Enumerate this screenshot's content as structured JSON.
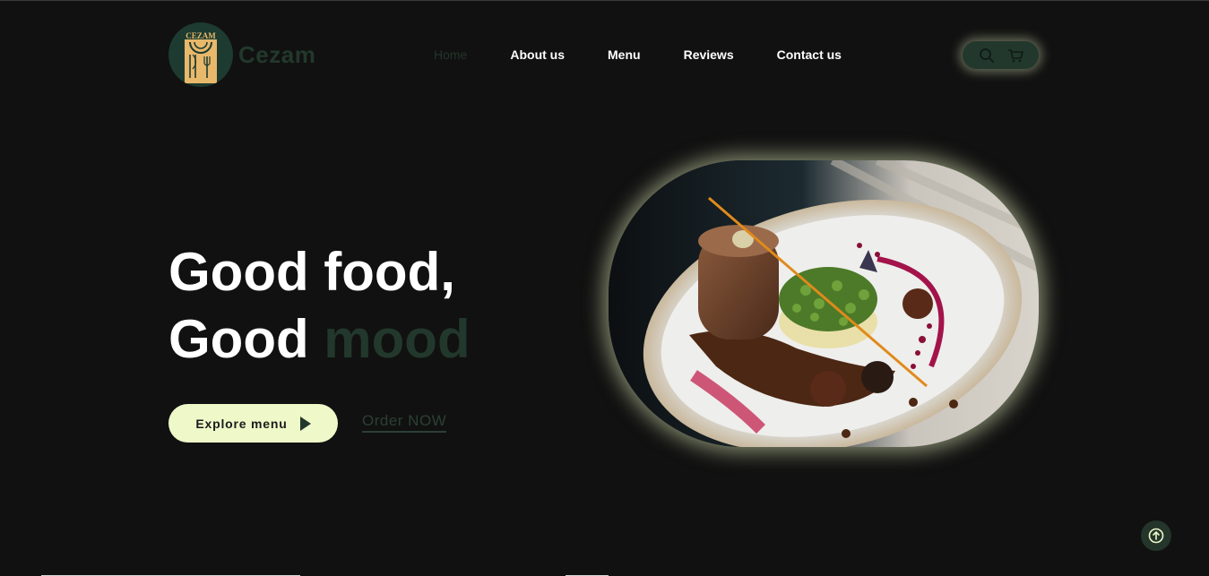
{
  "brand": {
    "name": "Cezam",
    "logo_text": "CEZAM"
  },
  "nav": {
    "items": [
      {
        "label": "Home",
        "active": true
      },
      {
        "label": "About us",
        "active": false
      },
      {
        "label": "Menu",
        "active": false
      },
      {
        "label": "Reviews",
        "active": false
      },
      {
        "label": "Contact us",
        "active": false
      }
    ]
  },
  "tools": {
    "search_icon": "search-icon",
    "cart_icon": "cart-icon"
  },
  "hero": {
    "line1": "Good food,",
    "line2_plain": "Good",
    "line2_accent": "mood",
    "explore_label": "Explore menu",
    "order_label": "Order NOW"
  },
  "colors": {
    "background": "#111111",
    "accent_green": "#22382c",
    "button_bg": "#eef8c8",
    "logo_gold": "#e8b86b"
  }
}
